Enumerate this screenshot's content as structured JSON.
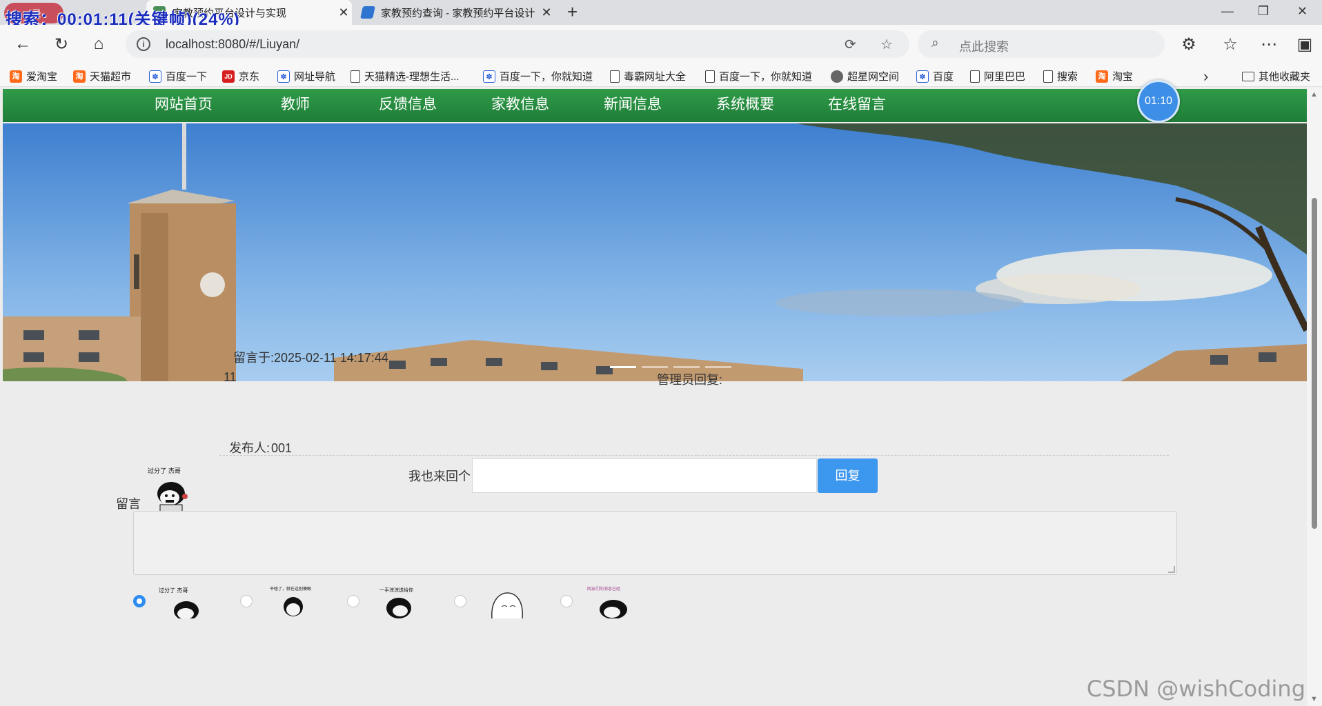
{
  "recorder": {
    "label": "录",
    "overlay": "搜索：00:01:11(关键帧)(24%)"
  },
  "tabs": [
    {
      "title": "家教预约平台设计与实现",
      "active": true
    },
    {
      "title": "家教预约查询 - 家教预约平台设计",
      "active": false
    }
  ],
  "address": {
    "url": "localhost:8080/#/Liuyan/",
    "search_placeholder": "点此搜索"
  },
  "bookmarks": [
    {
      "label": "爱淘宝",
      "icon": "taobao-icon"
    },
    {
      "label": "天猫超市",
      "icon": "taobao-icon"
    },
    {
      "label": "百度一下",
      "icon": "baidu-paw-icon"
    },
    {
      "label": "京东",
      "icon": "jd-icon"
    },
    {
      "label": "网址导航",
      "icon": "baidu-paw-icon"
    },
    {
      "label": "天猫精选-理想生活...",
      "icon": "page-icon"
    },
    {
      "label": "百度一下，你就知道",
      "icon": "baidu-paw-icon"
    },
    {
      "label": "毒霸网址大全",
      "icon": "page-icon"
    },
    {
      "label": "百度一下，你就知道",
      "icon": "page-icon"
    },
    {
      "label": "超星网空间",
      "icon": "globe-icon"
    },
    {
      "label": "百度",
      "icon": "baidu-paw-icon"
    },
    {
      "label": "阿里巴巴",
      "icon": "page-icon"
    },
    {
      "label": "搜索",
      "icon": "page-icon"
    },
    {
      "label": "淘宝",
      "icon": "taobao-icon"
    }
  ],
  "bookmarks_other": "其他收藏夹",
  "nav": [
    "网站首页",
    "教师",
    "反馈信息",
    "家教信息",
    "新闻信息",
    "系统概要",
    "在线留言"
  ],
  "timer": "01:10",
  "message": {
    "time": "留言于:2025-02-11 14:17:44",
    "content": "11",
    "admin_reply_label": "管理员回复:",
    "poster_label": "发布人:",
    "poster": "001",
    "avatar_caption": "过分了 杰哥"
  },
  "reply": {
    "label": "我也来回个",
    "value": "",
    "button": "回复"
  },
  "form": {
    "message_label": "留言",
    "message_value": ""
  },
  "emojis": [
    {
      "caption": "过分了 杰哥",
      "selected": true
    },
    {
      "caption": "干啥了，就在这别傻眼",
      "selected": false
    },
    {
      "caption": "一手涼涼送给你",
      "selected": false
    },
    {
      "caption": "",
      "selected": false
    },
    {
      "caption": "网友们的消息已经",
      "selected": false
    }
  ],
  "watermark": "CSDN @wishCoding"
}
